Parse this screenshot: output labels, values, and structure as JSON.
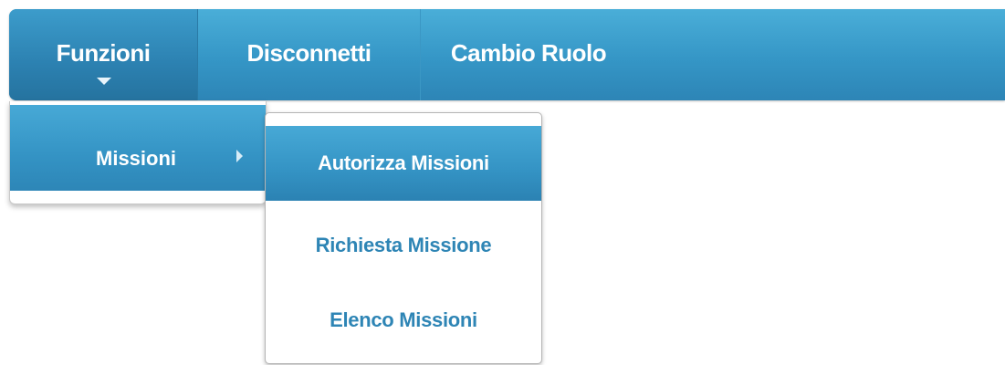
{
  "navbar": {
    "items": [
      {
        "label": "Funzioni"
      },
      {
        "label": "Disconnetti"
      },
      {
        "label": "Cambio Ruolo"
      }
    ]
  },
  "dropdown": {
    "items": [
      {
        "label": "Missioni"
      }
    ]
  },
  "submenu": {
    "items": [
      {
        "label": "Autorizza Missioni",
        "active": true
      },
      {
        "label": "Richiesta Missione"
      },
      {
        "label": "Elenco Missioni"
      }
    ]
  },
  "icons": {
    "funzioni_caret": "chevron-down-icon",
    "missioni_caret": "chevron-right-icon"
  },
  "colors": {
    "accent": "#3596c6",
    "link_text": "#2e85b5"
  }
}
